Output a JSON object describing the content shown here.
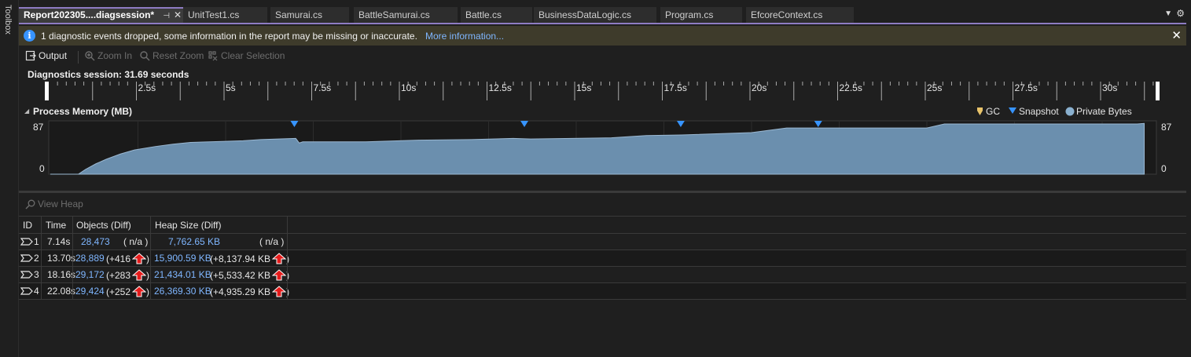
{
  "toolbox": {
    "label": "Toolbox"
  },
  "tabs": [
    {
      "label": "Report202305....diagsession*",
      "active": true
    },
    {
      "label": "UnitTest1.cs"
    },
    {
      "label": "Samurai.cs"
    },
    {
      "label": "BattleSamurai.cs"
    },
    {
      "label": "Battle.cs"
    },
    {
      "label": "BusinessDataLogic.cs"
    },
    {
      "label": "Program.cs"
    },
    {
      "label": "EfcoreContext.cs"
    }
  ],
  "infobar": {
    "message": "1 diagnostic events dropped, some information in the report may be missing or inaccurate.",
    "link": "More information..."
  },
  "toolbar": {
    "output": "Output",
    "zoom_in": "Zoom In",
    "reset_zoom": "Reset Zoom",
    "clear_selection": "Clear Selection"
  },
  "session": {
    "label": "Diagnostics session: 31.69 seconds"
  },
  "ruler": {
    "ticks": [
      "2.5s",
      "5s",
      "7.5s",
      "10s",
      "12.5s",
      "15s",
      "17.5s",
      "20s",
      "22.5s",
      "25s",
      "27.5s",
      "30s"
    ]
  },
  "chart": {
    "title": "Process Memory (MB)",
    "legend": {
      "gc": "GC",
      "snapshot": "Snapshot",
      "private_bytes": "Private Bytes"
    },
    "y_max_label": "87",
    "y_min_label": "0",
    "colors": {
      "area": "#6b8fae",
      "snapshot": "#3794ff",
      "gc": "#e8c36a"
    }
  },
  "chart_data": {
    "type": "area",
    "title": "Process Memory (MB)",
    "xlabel": "",
    "ylabel": "",
    "xlim": [
      0,
      31.69
    ],
    "ylim": [
      0,
      87
    ],
    "series": [
      {
        "name": "Private Bytes",
        "x": [
          0,
          0.8,
          1.0,
          1.3,
          1.6,
          2.0,
          2.4,
          3.0,
          3.5,
          4.0,
          5.0,
          5.5,
          6.0,
          7.0,
          7.1,
          7.2,
          9.0,
          10.5,
          12.0,
          13.2,
          13.7,
          16.0,
          17.0,
          18.0,
          20.0,
          21.0,
          22.0,
          25.0,
          25.5,
          31.0,
          31.2
        ],
        "values": [
          0,
          0,
          8,
          18,
          26,
          35,
          42,
          48,
          52,
          55,
          57,
          58,
          60,
          62,
          54,
          56,
          56,
          59,
          60,
          62,
          61,
          63,
          67,
          68,
          72,
          80,
          80,
          80,
          87,
          87,
          88
        ]
      }
    ],
    "snapshots_s": [
      7.14,
      13.7,
      18.16,
      22.08
    ],
    "grid": true
  },
  "heap": {
    "view_heap": "View Heap"
  },
  "table": {
    "headers": [
      "ID",
      "Time",
      "Objects (Diff)",
      "Heap Size (Diff)"
    ],
    "rows": [
      {
        "id": "1",
        "time": "7.14s",
        "objects": "28,473",
        "objects_diff": "( n/a )",
        "objects_up": false,
        "heap": "7,762.65 KB",
        "heap_diff": "( n/a )",
        "heap_up": false
      },
      {
        "id": "2",
        "time": "13.70s",
        "objects": "28,889",
        "objects_diff": "(+416",
        "objects_up": true,
        "heap": "15,900.59 KB",
        "heap_diff": "(+8,137.94 KB",
        "heap_up": true
      },
      {
        "id": "3",
        "time": "18.16s",
        "objects": "29,172",
        "objects_diff": "(+283",
        "objects_up": true,
        "heap": "21,434.01 KB",
        "heap_diff": "(+5,533.42 KB",
        "heap_up": true
      },
      {
        "id": "4",
        "time": "22.08s",
        "objects": "29,424",
        "objects_diff": "(+252",
        "objects_up": true,
        "heap": "26,369.30 KB",
        "heap_diff": "(+4,935.29 KB",
        "heap_up": true
      }
    ]
  }
}
